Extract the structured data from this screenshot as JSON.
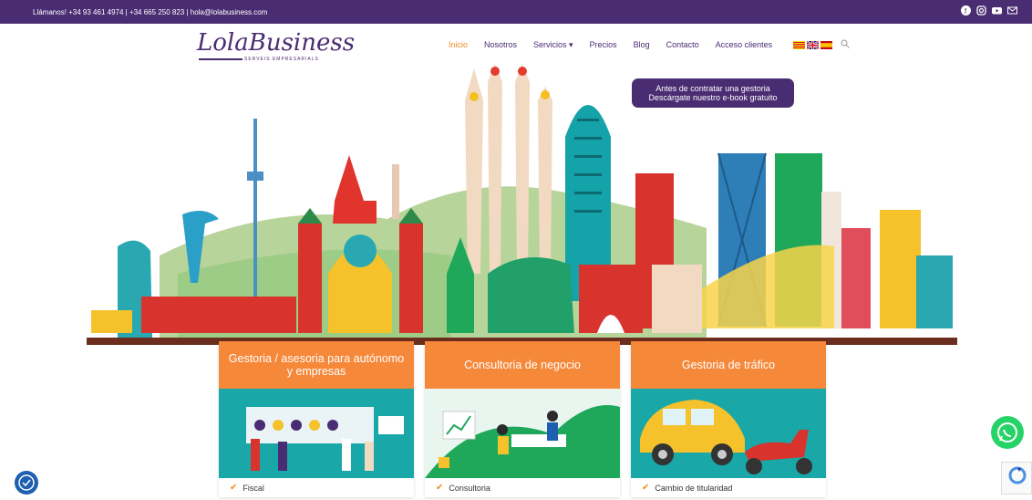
{
  "topbar": {
    "contact": "Llámanos! +34 93 461 4974  |  +34 665 250 823  |  hola@lolabusiness.com",
    "social_icons": [
      "facebook-icon",
      "instagram-icon",
      "youtube-icon",
      "email-icon"
    ]
  },
  "logo": {
    "name": "LolaBusiness",
    "tagline": "SERVEIS EMPRESARIALS"
  },
  "nav": {
    "items": [
      "Inicio",
      "Nosotros",
      "Servicios ▾",
      "Precios",
      "Blog",
      "Contacto",
      "Acceso clientes"
    ],
    "active": "Inicio"
  },
  "languages": [
    "ca",
    "en",
    "es"
  ],
  "promo": {
    "line1": "Antes de contratar una gestoria",
    "line2": "Descárgate nuestro e-book gratuito"
  },
  "cards": [
    {
      "title": "Gestoria / asesoria para autónomo y empresas",
      "feature": "Fiscal"
    },
    {
      "title": "Consultoria de negocio",
      "feature": "Consultoria"
    },
    {
      "title": "Gestoria de tráfico",
      "feature": "Cambio de titularidad"
    }
  ],
  "colors": {
    "primary": "#4a2c72",
    "accent": "#f08a24",
    "card_header": "#f6883a",
    "whatsapp": "#25d366"
  }
}
